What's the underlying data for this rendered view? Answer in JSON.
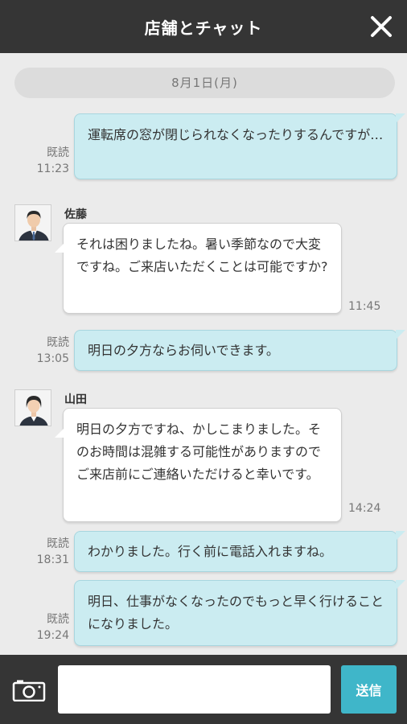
{
  "header": {
    "title": "店舗とチャット"
  },
  "date_divider": "8月1日(月)",
  "messages": [
    {
      "side": "mine",
      "read": "既読",
      "time": "11:23",
      "text": "運転席の窓が閉じられなくなったりするんですが…"
    },
    {
      "side": "theirs",
      "sender": "佐藤",
      "time": "11:45",
      "text": "それは困りましたね。暑い季節なので大変ですね。ご来店いただくことは可能ですか?"
    },
    {
      "side": "mine",
      "read": "既読",
      "time": "13:05",
      "text": "明日の夕方ならお伺いできます。"
    },
    {
      "side": "theirs",
      "sender": "山田",
      "time": "14:24",
      "text": "明日の夕方ですね、かしこまりました。そのお時間は混雑する可能性がありますのでご来店前にご連絡いただけると幸いです。"
    },
    {
      "side": "mine",
      "read": "既読",
      "time": "18:31",
      "text": "わかりました。行く前に電話入れますね。"
    },
    {
      "side": "mine",
      "read": "既読",
      "time": "19:24",
      "text": "明日、仕事がなくなったのでもっと早く行けることになりました。"
    }
  ],
  "composer": {
    "input_value": "",
    "send_label": "送信"
  },
  "icons": {
    "close": "close-icon",
    "camera": "camera-icon"
  },
  "colors": {
    "header_bg": "#353535",
    "my_bubble": "#cbecf1",
    "send_button": "#3fb6c9"
  }
}
